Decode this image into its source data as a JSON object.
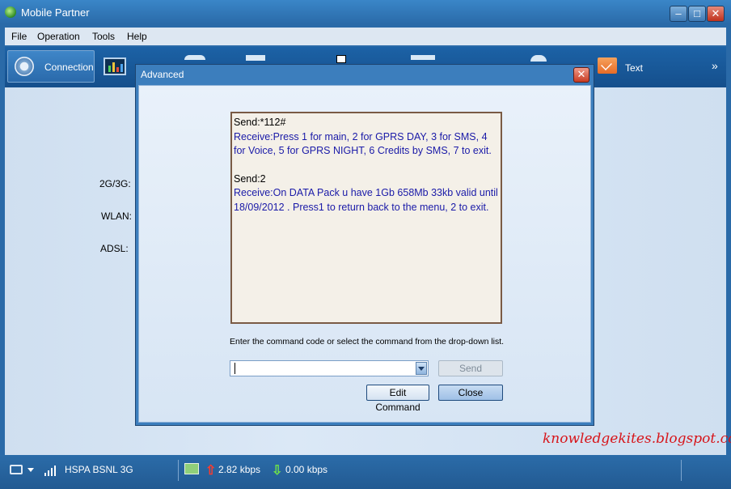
{
  "window": {
    "title": "Mobile Partner",
    "controls": {
      "minimize": "–",
      "maximize": "□",
      "close": "✕"
    }
  },
  "menu": {
    "items": [
      "File",
      "Operation",
      "Tools",
      "Help"
    ]
  },
  "toolbar": {
    "connection_label": "Connection",
    "text_label": "Text",
    "more": "»"
  },
  "main": {
    "labels": {
      "g2g3": "2G/3G:",
      "wlan": "WLAN:",
      "adsl": "ADSL:"
    }
  },
  "dialog": {
    "title": "Advanced",
    "close": "✕",
    "log": [
      {
        "kind": "send",
        "text": "Send:*112#"
      },
      {
        "kind": "recv",
        "text": "Receive:Press 1 for main, 2 for GPRS DAY, 3 for SMS, 4 for Voice, 5 for GPRS NIGHT, 6 Credits by SMS, 7 to exit."
      },
      {
        "kind": "send",
        "text": "Send:2"
      },
      {
        "kind": "recv",
        "text": "Receive:On DATA Pack u have 1Gb 658Mb 33kb valid until 18/09/2012  . Press1 to return back to the menu, 2 to exit."
      }
    ],
    "prompt": "Enter the command code or select the command from the drop-down list.",
    "command_value": "",
    "send_label": "Send",
    "edit_label": "Edit Command",
    "close_label": "Close"
  },
  "status": {
    "network": "HSPA BSNL 3G",
    "upload": "2.82 kbps",
    "download": "0.00 kbps"
  },
  "watermark": "knowledgekites.blogspot.com",
  "colors": {
    "accent": "#2a6aa8",
    "recv_text": "#1a1aa8",
    "watermark": "#d7151a"
  }
}
